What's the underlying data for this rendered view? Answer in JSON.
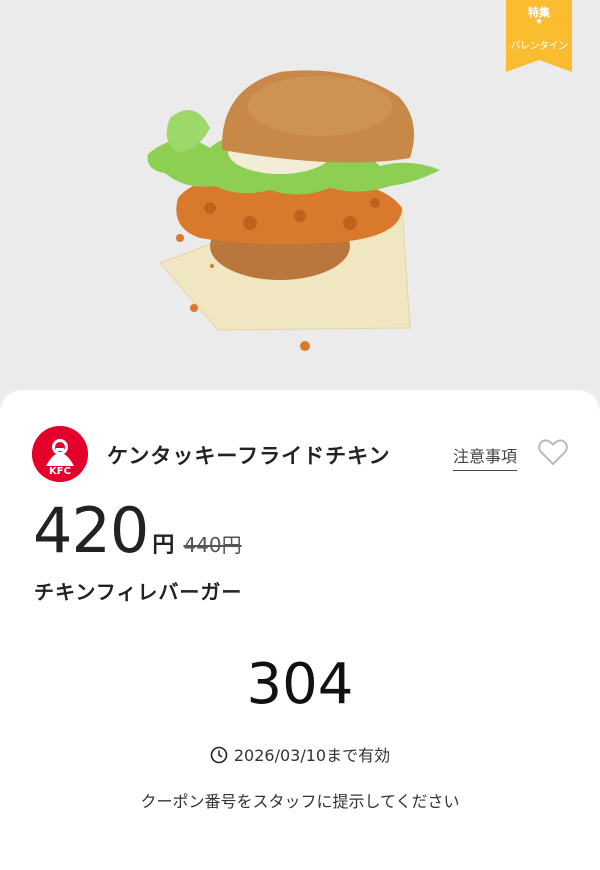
{
  "badge": {
    "top": "特集",
    "star": "★",
    "bottom": "バレンタイン"
  },
  "shop": {
    "name": "ケンタッキーフライドチキン",
    "logo_text": "KFC"
  },
  "notes_link": "注意事項",
  "price": {
    "current": "420",
    "unit": "円",
    "original": "440円"
  },
  "product_name": "チキンフィレバーガー",
  "coupon_code": "304",
  "validity": "2026/03/10まで有効",
  "instruction": "クーポン番号をスタッフに提示してください",
  "icons": {
    "heart": "heart-outline-icon",
    "clock": "clock-icon"
  },
  "colors": {
    "badge": "#fbbd30",
    "brand": "#e4002b",
    "background": "#ebebeb"
  }
}
